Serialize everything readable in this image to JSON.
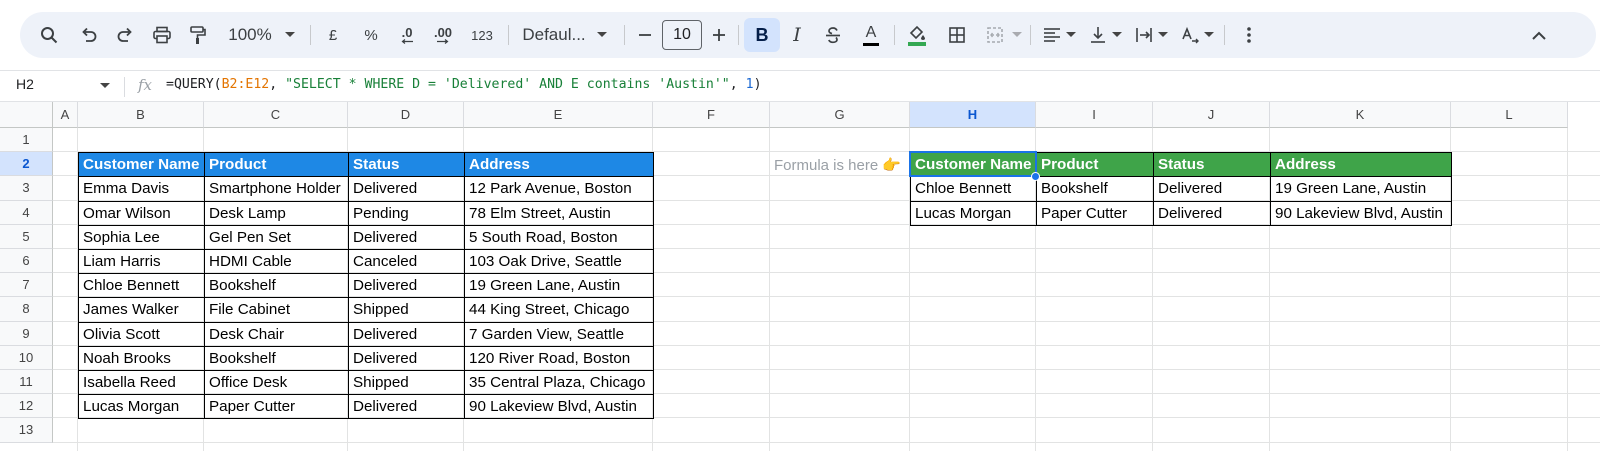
{
  "toolbar": {
    "zoom": "100%",
    "currency": "£",
    "percent": "%",
    "dec_decrease": ".0",
    "dec_increase": ".00",
    "number_format": "123",
    "font": "Defaul...",
    "font_size": "10",
    "bold": "B",
    "italic": "I",
    "text_color": "A"
  },
  "formula_bar": {
    "cell_ref": "H2",
    "fx": "fx",
    "formula_prefix": "=QUERY(",
    "formula_range": "B2:E12",
    "formula_sep": ", ",
    "formula_string": "\"SELECT * WHERE D = 'Delivered' AND E contains 'Austin'\"",
    "formula_sep2": ", ",
    "formula_number": "1",
    "formula_close": ")"
  },
  "columns": [
    "A",
    "B",
    "C",
    "D",
    "E",
    "F",
    "G",
    "H",
    "I",
    "J",
    "K",
    "L"
  ],
  "rows": [
    "1",
    "2",
    "3",
    "4",
    "5",
    "6",
    "7",
    "8",
    "9",
    "10",
    "11",
    "12",
    "13"
  ],
  "source_table": {
    "headers": [
      "Customer Name",
      "Product",
      "Status",
      "Address"
    ],
    "rows": [
      [
        "Emma Davis",
        "Smartphone Holder",
        "Delivered",
        "12 Park Avenue, Boston"
      ],
      [
        "Omar Wilson",
        "Desk Lamp",
        "Pending",
        "78 Elm Street, Austin"
      ],
      [
        "Sophia Lee",
        "Gel Pen Set",
        "Delivered",
        "5 South Road, Boston"
      ],
      [
        "Liam Harris",
        "HDMI Cable",
        "Canceled",
        "103 Oak Drive, Seattle"
      ],
      [
        "Chloe Bennett",
        "Bookshelf",
        "Delivered",
        "19 Green Lane, Austin"
      ],
      [
        "James Walker",
        "File Cabinet",
        "Shipped",
        "44 King Street, Chicago"
      ],
      [
        "Olivia Scott",
        "Desk Chair",
        "Delivered",
        "7 Garden View, Seattle"
      ],
      [
        "Noah Brooks",
        "Bookshelf",
        "Delivered",
        "120 River Road, Boston"
      ],
      [
        "Isabella Reed",
        "Office Desk",
        "Shipped",
        "35 Central Plaza, Chicago"
      ],
      [
        "Lucas Morgan",
        "Paper Cutter",
        "Delivered",
        "90 Lakeview Blvd, Austin"
      ]
    ]
  },
  "note": "Formula is here 👉",
  "result_table": {
    "headers": [
      "Customer Name",
      "Product",
      "Status",
      "Address"
    ],
    "rows": [
      [
        "Chloe Bennett",
        "Bookshelf",
        "Delivered",
        "19 Green Lane, Austin"
      ],
      [
        "Lucas Morgan",
        "Paper Cutter",
        "Delivered",
        "90 Lakeview Blvd, Austin"
      ]
    ]
  },
  "colors": {
    "source_header": "#1e88e5",
    "result_header": "#3fa449",
    "selection": "#1a73e8"
  }
}
